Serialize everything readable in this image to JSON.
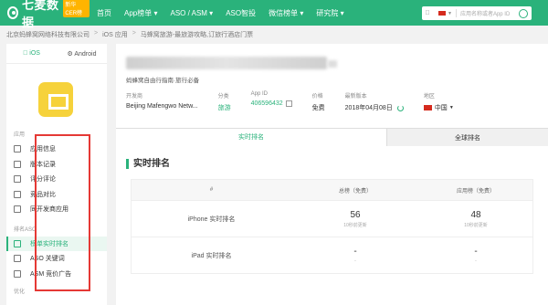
{
  "topbar": {
    "logo_text": "七麦数据",
    "logo_badge": "新华CER榜",
    "nav": [
      "首页",
      "App榜单 ▾",
      "ASO / ASM ▾",
      "ASO智投",
      "微信榜单 ▾",
      "研究院 ▾"
    ],
    "search_placeholder": "应用名称或者App ID",
    "colors": {
      "brand": "#2ab27b"
    }
  },
  "breadcrumb": [
    "北京蚂蜂窝网络科技有限公司",
    ">",
    "iOS 应用",
    ">",
    "马蜂窝旅游-最旅游攻略,订旅行酒店门票"
  ],
  "sidebar": {
    "os_tabs": [
      "iOS",
      "Android"
    ],
    "section_app": "应用",
    "items_app": [
      "应用信息",
      "版本记录",
      "评分评论",
      "竞品对比",
      "同开发商应用"
    ],
    "section_rank": "排名ASO",
    "items_rank": [
      "榜单实时排名",
      "ASO 关键词",
      "ASM 竞价广告"
    ],
    "section_opt": "优化"
  },
  "app": {
    "subtitle": "蚂蜂窝自由行指南·旅行必备",
    "info": {
      "developer_label": "开发商",
      "developer": "Beijing Mafengwo Netw...",
      "category_label": "分类",
      "category": "旅游",
      "appid_label": "App ID",
      "appid": "406596432",
      "price_label": "价格",
      "price": "免费",
      "version_label": "最新版本",
      "version": "2018年04月08日",
      "region_label": "地区",
      "region": "中国"
    }
  },
  "tabs": {
    "active": "实时排名",
    "inactive": "全球排名"
  },
  "section_title": "实时排名",
  "table": {
    "headers": [
      "#",
      "总榜（免费）",
      "应用榜（免费）"
    ],
    "rows": [
      {
        "label": "iPhone 实时排名",
        "total": "56",
        "total_upd": "10秒前更新",
        "app": "48",
        "app_upd": "10秒前更新"
      },
      {
        "label": "iPad 实时排名",
        "total": "-",
        "total_upd": "-",
        "app": "-",
        "app_upd": "-"
      }
    ]
  }
}
